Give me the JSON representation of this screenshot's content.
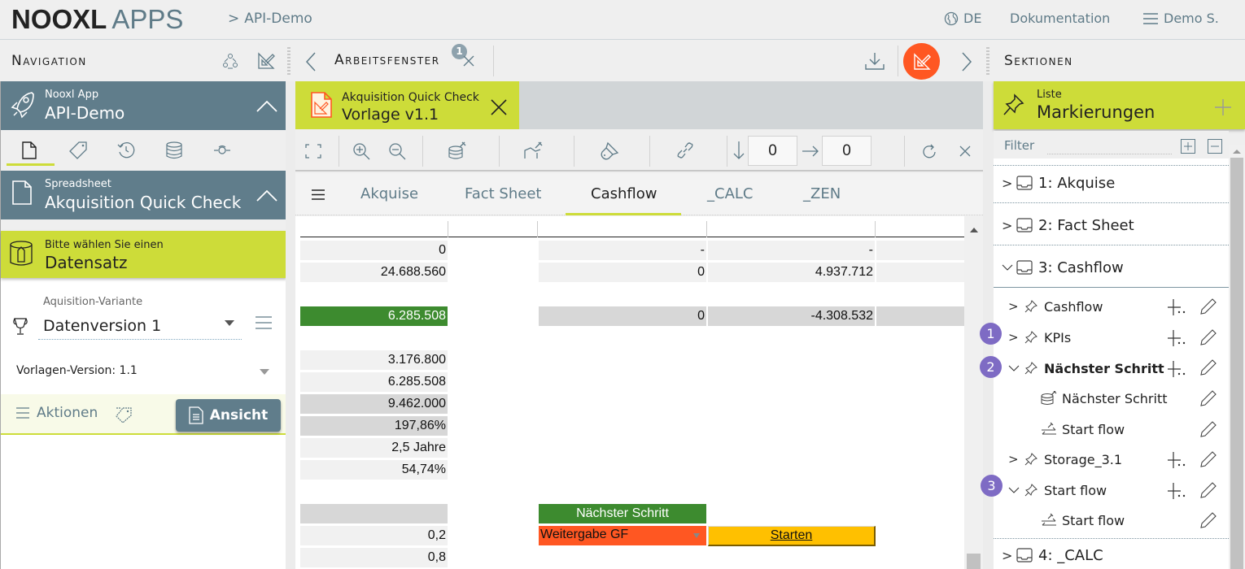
{
  "header": {
    "logo_main": "NOOXL",
    "logo_apps": "APPS",
    "breadcrumb": "API-Demo",
    "language": "DE",
    "docs_link": "Dokumentation",
    "user_menu": "Demo S."
  },
  "navigation": {
    "title": "Navigation",
    "app_card": {
      "subtitle": "Nooxl App",
      "title": "API-Demo"
    },
    "icon_tabs": [
      "document-icon",
      "tag-icon",
      "history-icon",
      "database-icon",
      "eye-icon"
    ],
    "spreadsheet_card": {
      "subtitle": "Spreadsheet",
      "title": "Akquisition Quick Check"
    },
    "dataset_card": {
      "subtitle": "Bitte wählen Sie einen",
      "title": "Datensatz"
    },
    "variant": {
      "label": "Aquisition-Variante",
      "value": "Datenversion 1"
    },
    "template_version": "Vorlagen-Version: 1.1",
    "actions_label": "Aktionen",
    "view_button": "Ansicht"
  },
  "workspace": {
    "title": "Arbeitsfenster",
    "badge_count": "1",
    "active_tab": {
      "subtitle": "Akquisition Quick Check",
      "title": "Vorlage v1.1"
    },
    "toolbar": {
      "row_value": "0",
      "col_value": "0"
    },
    "sheet_tabs": [
      {
        "label": "Akquise",
        "active": false
      },
      {
        "label": "Fact Sheet",
        "active": false
      },
      {
        "label": "Cashflow",
        "active": true
      },
      {
        "label": "_CALC",
        "active": false
      },
      {
        "label": "_ZEN",
        "active": false
      }
    ],
    "grid": {
      "col_a": [
        "0",
        "24.688.560",
        "6.285.508",
        "3.176.800",
        "6.285.508",
        "9.462.000",
        "197,86%",
        "2,5 Jahre",
        "54,74%",
        "",
        "0,2",
        "0,8"
      ],
      "col_c": [
        "-",
        "0",
        "0"
      ],
      "col_d": [
        "-",
        "4.937.712",
        "-4.308.532"
      ],
      "next_step_header": "Nächster Schritt",
      "next_step_value": "Weitergabe GF",
      "start_button": "Starten"
    },
    "colors": {
      "green": "#3d8b2f",
      "orange": "#ff5722",
      "yellow": "#ffc000",
      "lime": "#cddc39"
    }
  },
  "sections": {
    "title": "Sektionen",
    "list_card": {
      "subtitle": "Liste",
      "title": "Markierungen"
    },
    "filter_label": "Filter",
    "tree": [
      {
        "label": "1: Akquise",
        "expanded": false
      },
      {
        "label": "2: Fact Sheet",
        "expanded": false
      },
      {
        "label": "3: Cashflow",
        "expanded": true
      },
      {
        "label": "4: _CALC",
        "expanded": false
      }
    ],
    "cashflow_children": [
      {
        "label": "Cashflow",
        "badge": ""
      },
      {
        "label": "KPIs",
        "badge": "1"
      },
      {
        "label": "Nächster Schritt",
        "badge": "2",
        "bold": true
      },
      {
        "label": "Nächster Schritt",
        "sub": true
      },
      {
        "label": "Start flow",
        "sub": true
      },
      {
        "label": "Storage_3.1",
        "badge": ""
      },
      {
        "label": "Start flow",
        "badge": "3"
      },
      {
        "label": "Start flow",
        "sub": true
      }
    ]
  }
}
